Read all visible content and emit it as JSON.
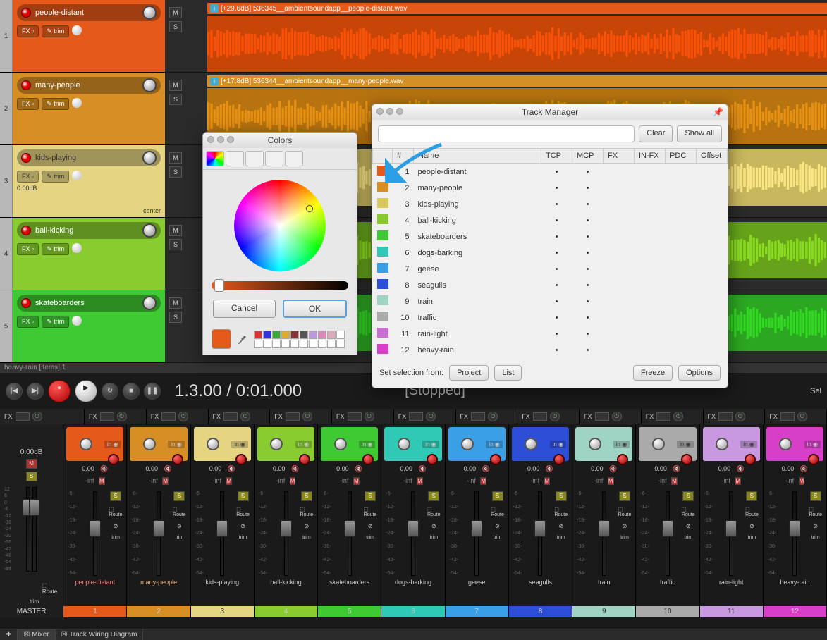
{
  "tracks": [
    {
      "num": 1,
      "name": "people-distant",
      "clip": "[+29.6dB] 536345__ambientsoundapp__people-distant.wav",
      "color": "#e55a1a",
      "wf": "wf1",
      "mix": "cm1"
    },
    {
      "num": 2,
      "name": "many-people",
      "clip": "[+17.8dB] 536344__ambientsoundapp__many-people.wav",
      "color": "#d68e25",
      "wf": "wf2",
      "mix": "cm2"
    },
    {
      "num": 3,
      "name": "kids-playing",
      "clip": "",
      "color": "#e5d582",
      "wf": "wf3",
      "mix": "cm3",
      "center": "center",
      "db": "0.00dB"
    },
    {
      "num": 4,
      "name": "ball-kicking",
      "clip": "",
      "color": "#88cc30",
      "wf": "wf4",
      "mix": "cm4"
    },
    {
      "num": 5,
      "name": "skateboarders",
      "clip": "",
      "color": "#3fc932",
      "wf": "wf5",
      "mix": "cm5"
    }
  ],
  "mixer_extra": [
    {
      "name": "dogs-barking",
      "mix": "cm6"
    },
    {
      "name": "geese",
      "mix": "cm7"
    },
    {
      "name": "seagulls",
      "mix": "cm8"
    },
    {
      "name": "train",
      "mix": "cm9"
    },
    {
      "name": "traffic",
      "mix": "cm10"
    },
    {
      "name": "rain-light",
      "mix": "cm11"
    },
    {
      "name": "heavy-rain",
      "mix": "cm12"
    }
  ],
  "mixer_vals": {
    "db": "0.00",
    "inf": "-inf",
    "trim": "trim",
    "route": "Route",
    "in": "in"
  },
  "mixer_scale": [
    "12",
    "6",
    "0",
    "-6",
    "-12",
    "-18",
    "-24",
    "-30",
    "-36",
    "-42",
    "-48",
    "-54",
    "-inf"
  ],
  "status": "heavy-rain [items] 1",
  "transport": {
    "time": "1.3.00 / 0:01.000",
    "state": "[Stopped]",
    "sel": "Sel"
  },
  "fx_label": "FX",
  "fx_btn": "FX",
  "trim_btn": "trim",
  "m": "M",
  "s": "S",
  "colors": {
    "title": "Colors",
    "cancel": "Cancel",
    "ok": "OK",
    "swatch": "#e55a1a",
    "grid": [
      "#d33",
      "#33d",
      "#3a3",
      "#da3",
      "#833",
      "#555",
      "#b9d",
      "#d8b",
      "#dab",
      "#fff",
      "#fff",
      "#fff",
      "#fff",
      "#fff",
      "#fff",
      "#fff",
      "#fff",
      "#fff",
      "#fff",
      "#fff"
    ]
  },
  "track_manager": {
    "title": "Track Manager",
    "clear": "Clear",
    "show_all": "Show all",
    "cols": [
      "",
      "#",
      "Name",
      "TCP",
      "MCP",
      "FX",
      "IN-FX",
      "PDC",
      "Offset"
    ],
    "rows": [
      {
        "c": "#e55a1a",
        "n": 1,
        "name": "people-distant"
      },
      {
        "c": "#d68e25",
        "n": 2,
        "name": "many-people"
      },
      {
        "c": "#d8c860",
        "n": 3,
        "name": "kids-playing"
      },
      {
        "c": "#8ac830",
        "n": 4,
        "name": "ball-kicking"
      },
      {
        "c": "#3fc932",
        "n": 5,
        "name": "skateboarders"
      },
      {
        "c": "#2fc9b5",
        "n": 6,
        "name": "dogs-barking"
      },
      {
        "c": "#3a9fe5",
        "n": 7,
        "name": "geese"
      },
      {
        "c": "#2d4ed6",
        "n": 8,
        "name": "seagulls"
      },
      {
        "c": "#9fd4c5",
        "n": 9,
        "name": "train"
      },
      {
        "c": "#aaa",
        "n": 10,
        "name": "traffic"
      },
      {
        "c": "#c86ed4",
        "n": 11,
        "name": "rain-light"
      },
      {
        "c": "#d83fc9",
        "n": 12,
        "name": "heavy-rain"
      }
    ],
    "set_sel": "Set selection from:",
    "project": "Project",
    "list": "List",
    "freeze": "Freeze",
    "options": "Options"
  },
  "master": {
    "label": "MASTER",
    "db": "0.00dB"
  },
  "footer": {
    "mixer": "Mixer",
    "wiring": "Track Wiring Diagram"
  },
  "dot": "•"
}
